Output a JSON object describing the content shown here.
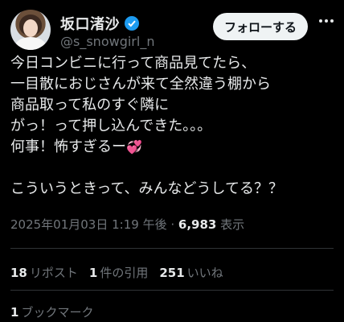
{
  "author": {
    "display_name": "坂口渚沙",
    "handle": "@s_snowgirl_n",
    "verified": true
  },
  "actions": {
    "follow_label": "フォローする"
  },
  "tweet": {
    "text": "今日コンビニに行って商品見てたら、\n一目散におじさんが来て全然違う棚から\n商品取って私のすぐ隣に\nがっ！って押し込んできた。。。\n何事！怖すぎるー",
    "emoji": "💞",
    "text2": "こういうときって、みんなどうしてる？？"
  },
  "meta": {
    "timestamp": "2025年01月03日 1:19 午後",
    "separator": " · ",
    "views": "6,983",
    "views_label": "表示"
  },
  "stats": [
    {
      "count": "18",
      "label": "リポスト"
    },
    {
      "count": "1",
      "label": "件の引用"
    },
    {
      "count": "251",
      "label": "いいね"
    }
  ],
  "bookmarks": {
    "count": "1",
    "label": "ブックマーク"
  },
  "colors": {
    "background": "#000000",
    "text": "#e7e9ea",
    "muted": "#71767b",
    "accent": "#1d9bf0",
    "divider": "#2f3336"
  }
}
